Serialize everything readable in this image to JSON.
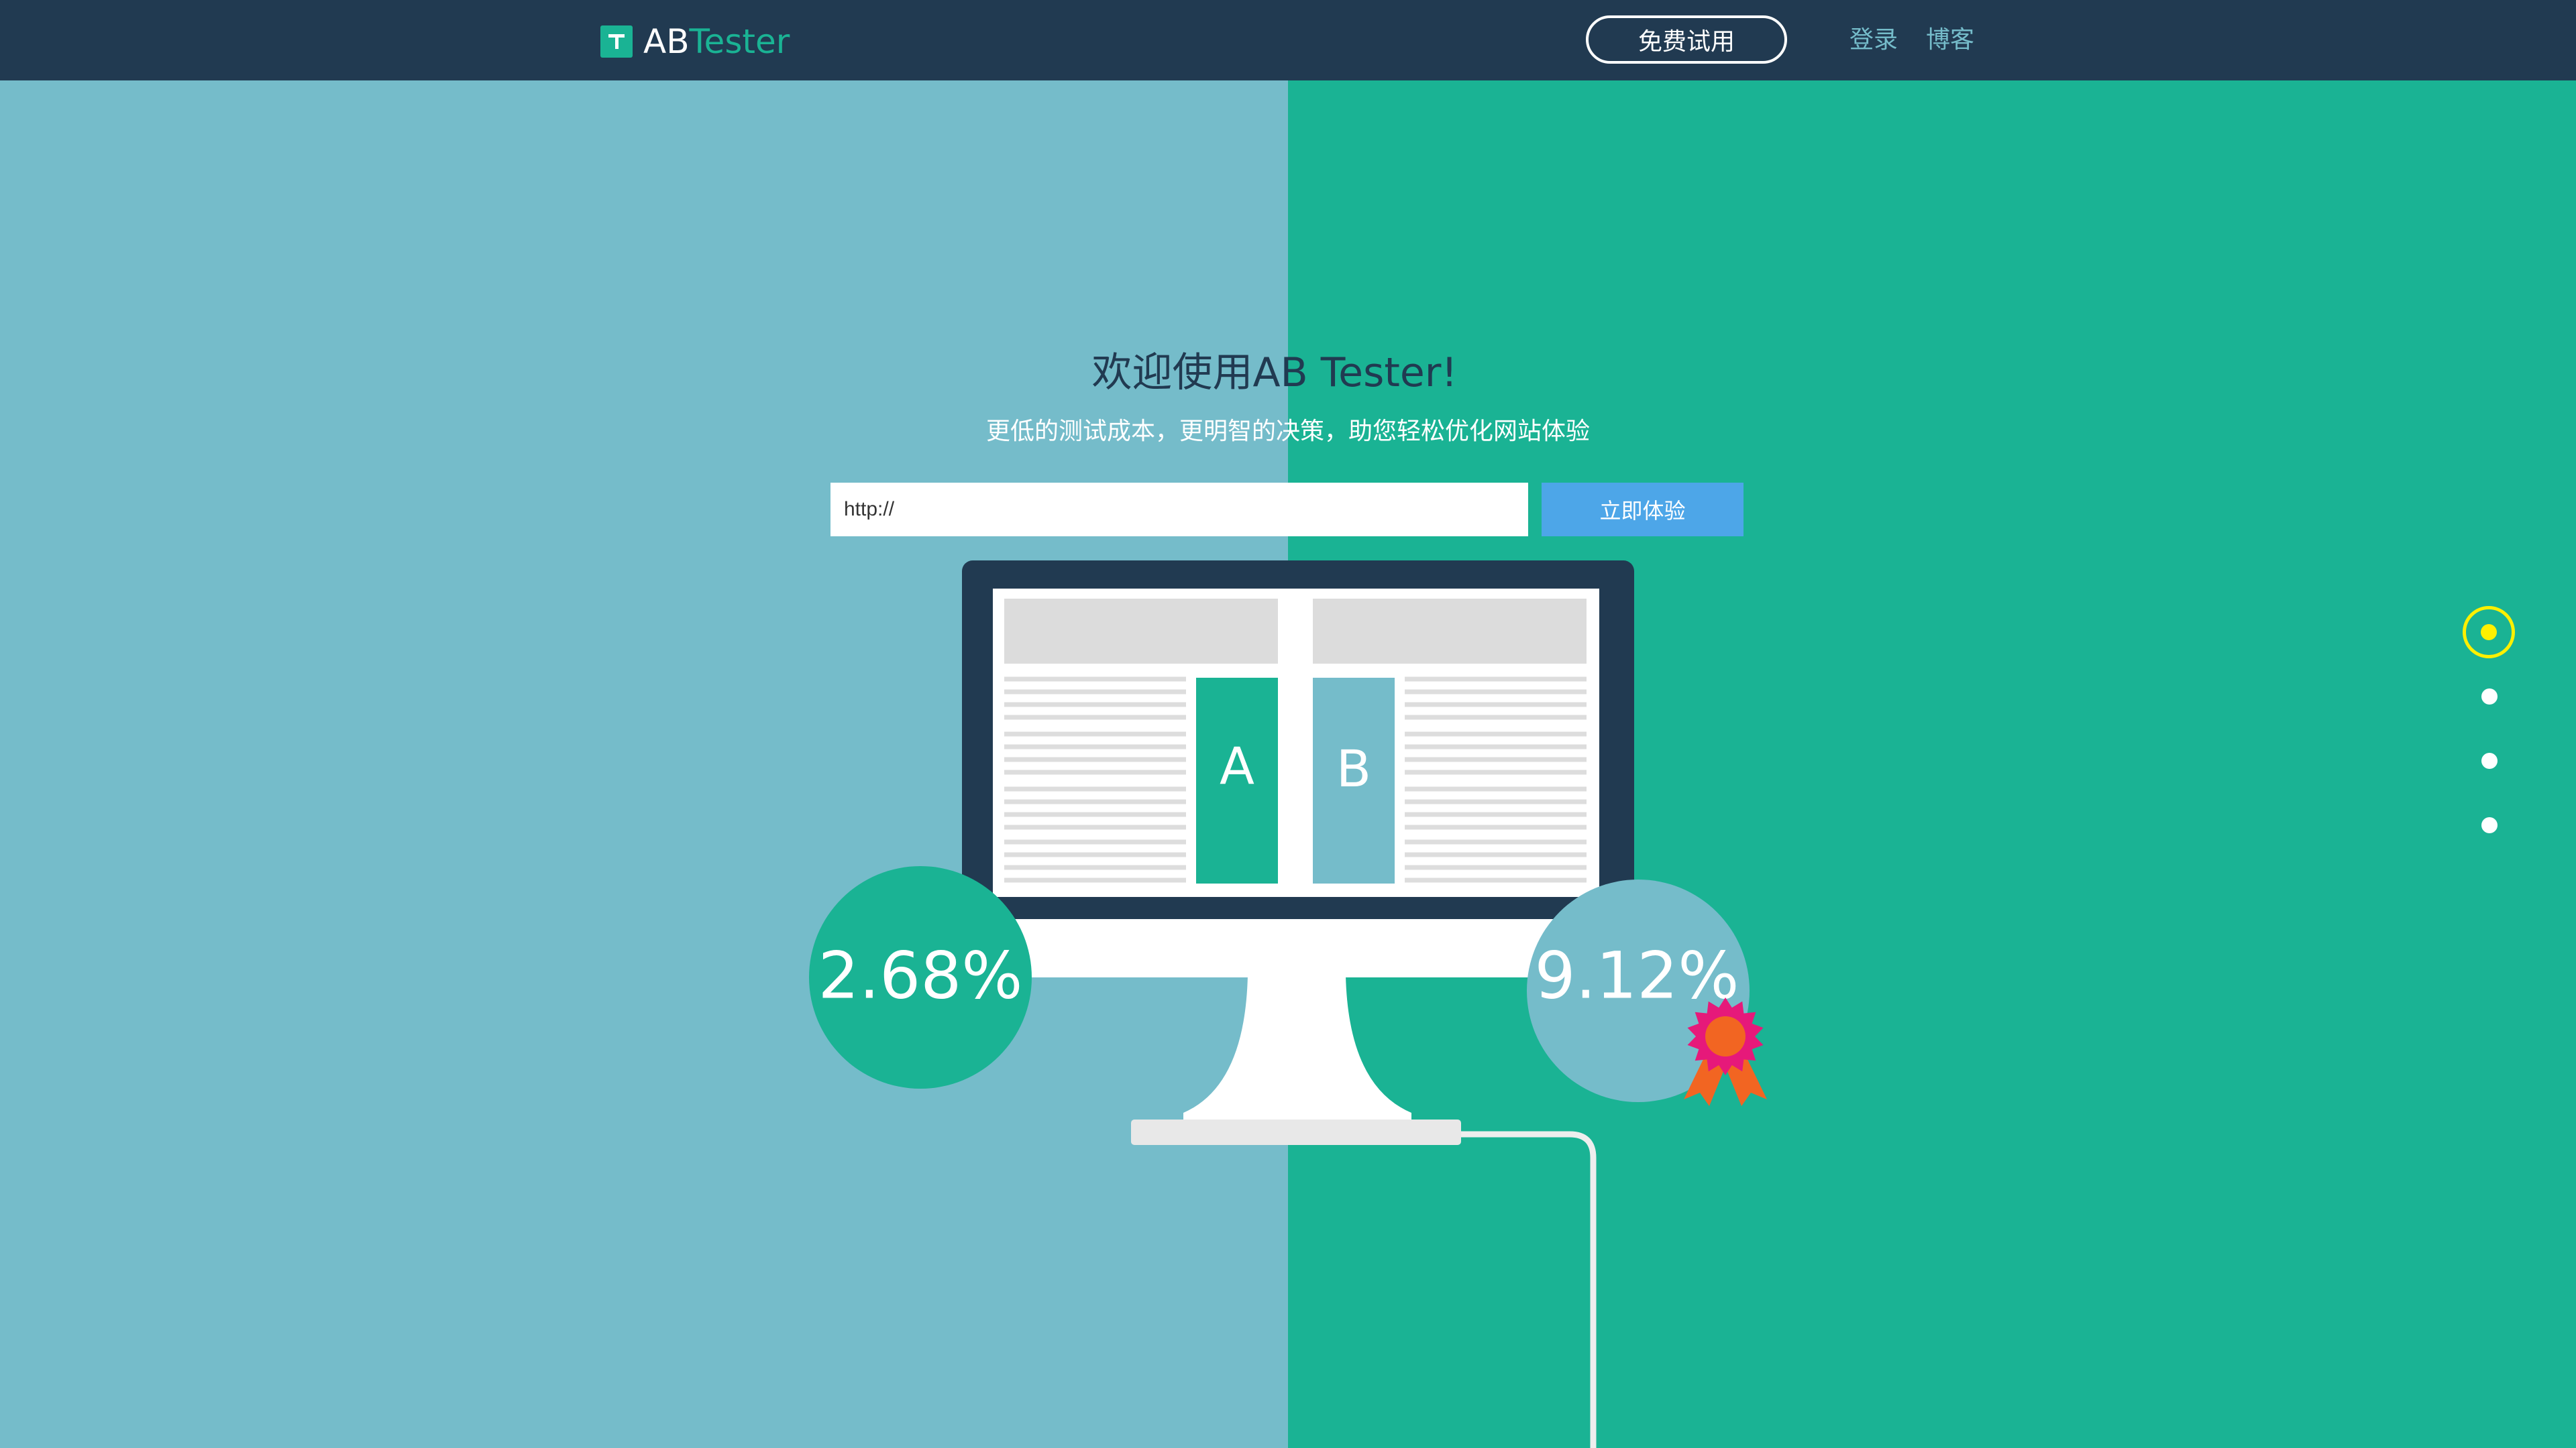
{
  "navbar": {
    "logo_ab": "AB",
    "logo_tester": "Tester",
    "trial_button": "免费试用",
    "login_link": "登录",
    "blog_link": "博客"
  },
  "hero": {
    "title": "欢迎使用AB Tester!",
    "subtitle": "更低的测试成本，更明智的决策，助您轻松优化网站体验",
    "url_input_value": "http://",
    "submit_button": "立即体验"
  },
  "illustration": {
    "variant_a_label": "A",
    "variant_b_label": "B",
    "variant_a_rate": "2.68%",
    "variant_b_rate": "9.12%",
    "badge_icon": "award-ribbon-icon"
  },
  "slide_nav": {
    "count": 4,
    "active_index": 0
  },
  "colors": {
    "navbar": "#213A51",
    "left_panel": "#75BCCA",
    "right_panel": "#1AB394",
    "submit_button": "#4DA6E8",
    "active_dot": "#FFF000",
    "badge": "#E6197A",
    "badge_center": "#F26522"
  }
}
